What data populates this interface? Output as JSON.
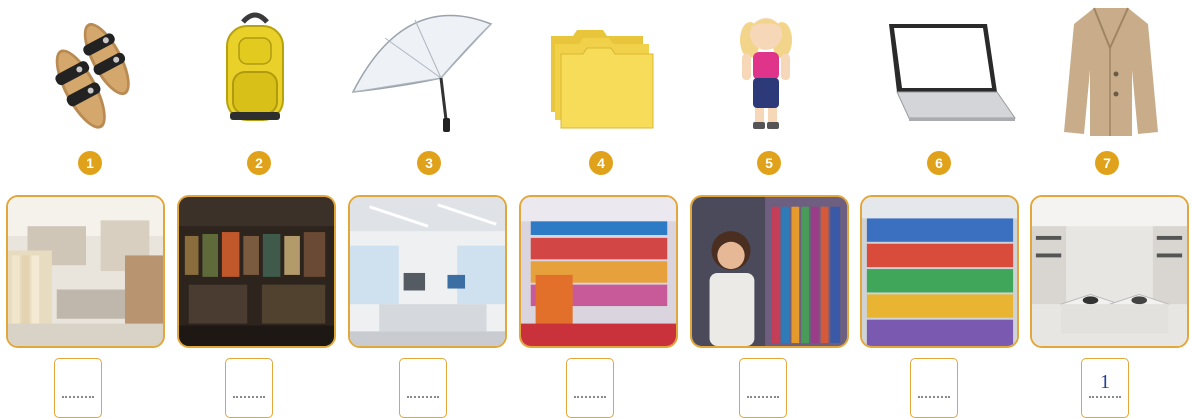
{
  "numbers": [
    "1",
    "2",
    "3",
    "4",
    "5",
    "6",
    "7"
  ],
  "answers": [
    "",
    "",
    "",
    "",
    "",
    "",
    "1"
  ],
  "colors": {
    "accent": "#e0a21b",
    "border": "#e2a73a",
    "answer_text": "#25408f"
  }
}
